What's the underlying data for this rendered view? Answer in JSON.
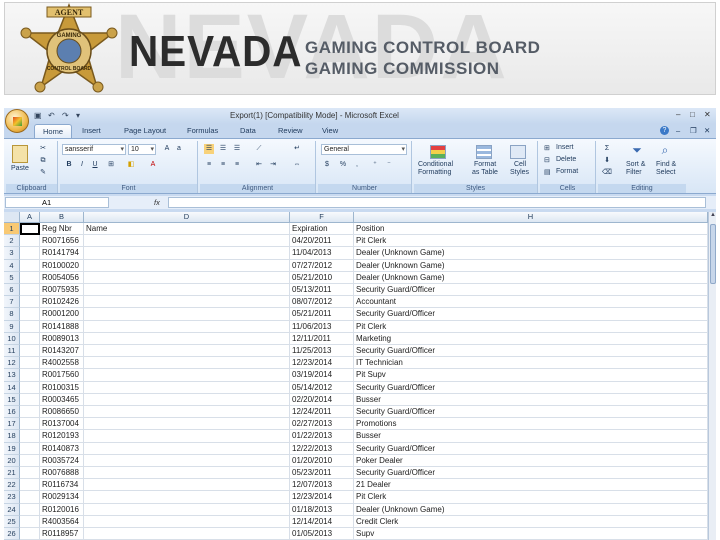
{
  "banner": {
    "watermark": "NEVADA",
    "title": "NEVADA",
    "subtitle1": "GAMING CONTROL BOARD",
    "subtitle2": "GAMING COMMISSION",
    "badge_top": "AGENT",
    "badge_mid": "GAMING",
    "badge_bottom": "CONTROL BOARD"
  },
  "excel": {
    "window_title": "Export(1)  [Compatibility Mode]  -  Microsoft Excel",
    "tabs": [
      "Home",
      "Insert",
      "Page Layout",
      "Formulas",
      "Data",
      "Review",
      "View"
    ],
    "ribbon": {
      "clipboard": {
        "paste": "Paste",
        "label": "Clipboard"
      },
      "font": {
        "name": "sansserif",
        "size": "10",
        "label": "Font",
        "bold": "B",
        "italic": "I",
        "underline": "U"
      },
      "alignment": {
        "label": "Alignment"
      },
      "number": {
        "format": "General",
        "currency": "$",
        "percent": "%",
        "comma": ",",
        "label": "Number"
      },
      "styles": {
        "conditional": "Conditional\nFormatting",
        "conditional1": "Conditional",
        "conditional2": "Formatting",
        "format_table1": "Format",
        "format_table2": "as Table",
        "cell_styles1": "Cell",
        "cell_styles2": "Styles",
        "label": "Styles"
      },
      "cells": {
        "insert": "Insert",
        "delete": "Delete",
        "format": "Format",
        "label": "Cells"
      },
      "editing": {
        "sort1": "Sort &",
        "sort2": "Filter",
        "find1": "Find &",
        "find2": "Select",
        "label": "Editing"
      }
    },
    "name_box": "A1",
    "fx": "fx",
    "columns": [
      "A",
      "B",
      "D",
      "F",
      "H"
    ],
    "rows": [
      {
        "n": "1",
        "reg": "Reg Nbr",
        "name": "Name",
        "exp": "Expiration",
        "pos": "Position"
      },
      {
        "n": "2",
        "reg": "R0071656",
        "name": "",
        "exp": "04/20/2011",
        "pos": "Pit Clerk"
      },
      {
        "n": "3",
        "reg": "R0141794",
        "name": "",
        "exp": "11/04/2013",
        "pos": "Dealer (Unknown Game)"
      },
      {
        "n": "4",
        "reg": "R0100020",
        "name": "",
        "exp": "07/27/2012",
        "pos": "Dealer (Unknown Game)"
      },
      {
        "n": "5",
        "reg": "R0054056",
        "name": "",
        "exp": "05/21/2010",
        "pos": "Dealer (Unknown Game)"
      },
      {
        "n": "6",
        "reg": "R0075935",
        "name": "",
        "exp": "05/13/2011",
        "pos": "Security Guard/Officer"
      },
      {
        "n": "7",
        "reg": "R0102426",
        "name": "",
        "exp": "08/07/2012",
        "pos": "Accountant"
      },
      {
        "n": "8",
        "reg": "R0001200",
        "name": "",
        "exp": "05/21/2011",
        "pos": "Security Guard/Officer"
      },
      {
        "n": "9",
        "reg": "R0141888",
        "name": "",
        "exp": "11/06/2013",
        "pos": "Pit Clerk"
      },
      {
        "n": "10",
        "reg": "R0089013",
        "name": "",
        "exp": "12/11/2011",
        "pos": "Marketing"
      },
      {
        "n": "11",
        "reg": "R0143207",
        "name": "",
        "exp": "11/25/2013",
        "pos": "Security Guard/Officer"
      },
      {
        "n": "12",
        "reg": "R4002558",
        "name": "",
        "exp": "12/23/2014",
        "pos": "IT Technician"
      },
      {
        "n": "13",
        "reg": "R0017560",
        "name": "",
        "exp": "03/19/2014",
        "pos": "Pit Supv"
      },
      {
        "n": "14",
        "reg": "R0100315",
        "name": "",
        "exp": "05/14/2012",
        "pos": "Security Guard/Officer"
      },
      {
        "n": "15",
        "reg": "R0003465",
        "name": "",
        "exp": "02/20/2014",
        "pos": "Busser"
      },
      {
        "n": "16",
        "reg": "R0086650",
        "name": "",
        "exp": "12/24/2011",
        "pos": "Security Guard/Officer"
      },
      {
        "n": "17",
        "reg": "R0137004",
        "name": "",
        "exp": "02/27/2013",
        "pos": "Promotions"
      },
      {
        "n": "18",
        "reg": "R0120193",
        "name": "",
        "exp": "01/22/2013",
        "pos": "Busser"
      },
      {
        "n": "19",
        "reg": "R0140873",
        "name": "",
        "exp": "12/22/2013",
        "pos": "Security Guard/Officer"
      },
      {
        "n": "20",
        "reg": "R0035724",
        "name": "",
        "exp": "01/20/2010",
        "pos": "Poker Dealer"
      },
      {
        "n": "21",
        "reg": "R0076888",
        "name": "",
        "exp": "05/23/2011",
        "pos": "Security Guard/Officer"
      },
      {
        "n": "22",
        "reg": "R0116734",
        "name": "",
        "exp": "12/07/2013",
        "pos": "21 Dealer"
      },
      {
        "n": "23",
        "reg": "R0029134",
        "name": "",
        "exp": "12/23/2014",
        "pos": "Pit Clerk"
      },
      {
        "n": "24",
        "reg": "R0120016",
        "name": "",
        "exp": "01/18/2013",
        "pos": "Dealer (Unknown Game)"
      },
      {
        "n": "25",
        "reg": "R4003564",
        "name": "",
        "exp": "12/14/2014",
        "pos": "Credit Clerk"
      },
      {
        "n": "26",
        "reg": "R0118957",
        "name": "",
        "exp": "01/05/2013",
        "pos": "Supv"
      }
    ]
  }
}
